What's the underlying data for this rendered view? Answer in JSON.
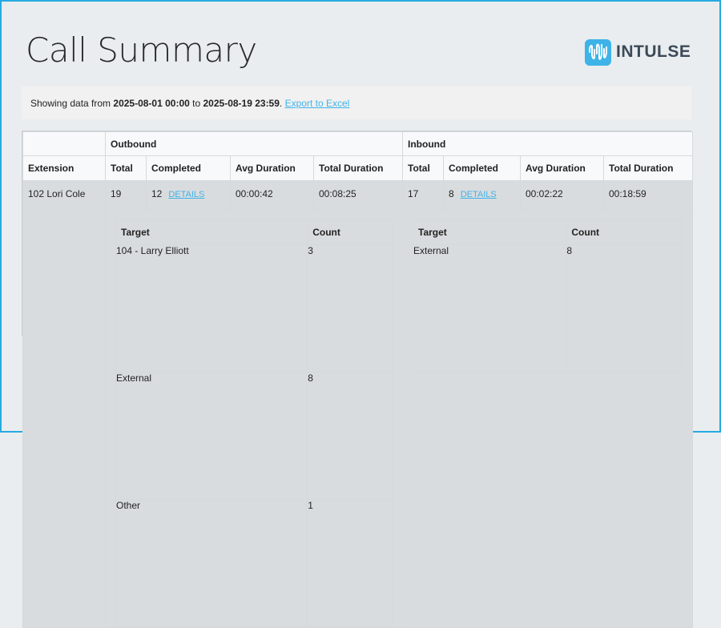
{
  "page": {
    "title": "Call Summary"
  },
  "logo": {
    "text": "INTULSE",
    "icon": "waveform-icon"
  },
  "info": {
    "prefix": "Showing data from ",
    "from": "2025-08-01 00:00",
    "middle": " to ",
    "to": "2025-08-19 23:59",
    "suffix": ". ",
    "export_label": "Export to Excel"
  },
  "table": {
    "groups": {
      "outbound": "Outbound",
      "inbound": "Inbound"
    },
    "columns": {
      "extension": "Extension",
      "total": "Total",
      "completed": "Completed",
      "avg_duration": "Avg Duration",
      "total_duration": "Total Duration"
    },
    "row": {
      "extension": "102 Lori Cole",
      "outbound": {
        "total": "19",
        "completed": "12",
        "details": "DETAILS",
        "avg": "00:00:42",
        "total_duration": "00:08:25"
      },
      "inbound": {
        "total": "17",
        "completed": "8",
        "details": "DETAILS",
        "avg": "00:02:22",
        "total_duration": "00:18:59"
      }
    },
    "outbound_detail": {
      "headers": {
        "target": "Target",
        "count": "Count"
      },
      "rows": [
        {
          "target": "104 - Larry Elliott",
          "count": "3"
        },
        {
          "target": "External",
          "count": "8"
        },
        {
          "target": "Other",
          "count": "1"
        }
      ]
    },
    "inbound_detail": {
      "headers": {
        "target": "Target",
        "count": "Count"
      },
      "rows": [
        {
          "target": "External",
          "count": "8"
        }
      ]
    }
  },
  "colors": {
    "accent": "#3eb3e8",
    "frame": "#27aae1",
    "row_bg": "#d9dcde"
  }
}
